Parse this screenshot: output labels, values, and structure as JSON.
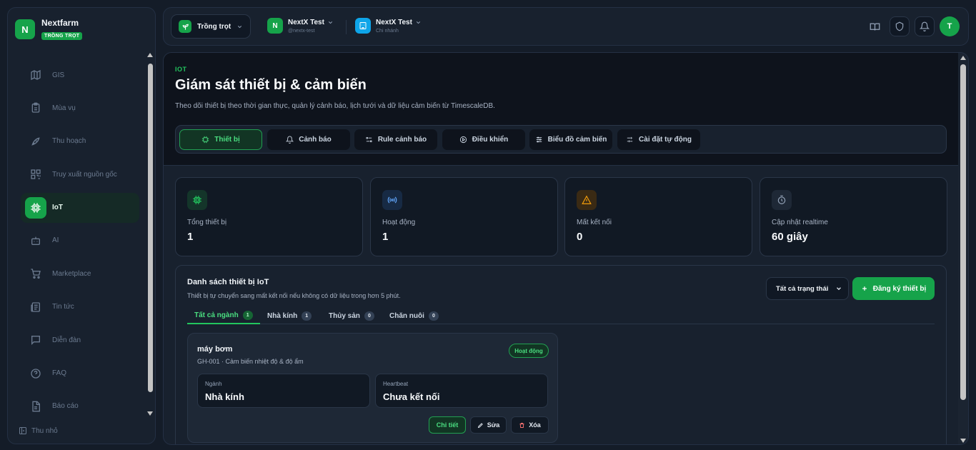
{
  "brand": {
    "name": "Nextfarm",
    "logo_letter": "N",
    "badge": "TRỒNG TRỌT"
  },
  "sidebar": {
    "items": [
      {
        "label": "GIS",
        "icon": "map-icon",
        "active": false
      },
      {
        "label": "Mùa vụ",
        "icon": "clipboard-icon",
        "active": false
      },
      {
        "label": "Thu hoạch",
        "icon": "rocket-icon",
        "active": false
      },
      {
        "label": "Truy xuất nguồn gốc",
        "icon": "qr-code-icon",
        "active": false
      },
      {
        "label": "IoT",
        "icon": "cpu-icon",
        "active": true
      },
      {
        "label": "AI",
        "icon": "robot-icon",
        "active": false
      },
      {
        "label": "Marketplace",
        "icon": "cart-icon",
        "active": false
      },
      {
        "label": "Tin tức",
        "icon": "newspaper-icon",
        "active": false
      },
      {
        "label": "Diễn đàn",
        "icon": "chat-icon",
        "active": false
      },
      {
        "label": "FAQ",
        "icon": "help-circle-icon",
        "active": false
      },
      {
        "label": "Báo cáo",
        "icon": "file-icon",
        "active": false
      }
    ],
    "collapse_label": "Thu nhỏ"
  },
  "topbar": {
    "crop_select": "Trồng trọt",
    "org": {
      "logo_letter": "N",
      "name": "NextX Test",
      "handle": "@nextx-test"
    },
    "branch": {
      "name": "NextX Test",
      "sub": "Chi nhánh"
    },
    "avatar_letter": "T"
  },
  "page": {
    "eyebrow": "IOT",
    "title": "Giám sát thiết bị & cảm biến",
    "description": "Theo dõi thiết bị theo thời gian thực, quản lý cảnh báo, lịch tưới và dữ liệu cảm biến từ TimescaleDB.",
    "tabs": [
      {
        "label": "Thiết bị",
        "icon": "chip-icon",
        "active": true
      },
      {
        "label": "Cảnh báo",
        "icon": "bell-icon",
        "active": false
      },
      {
        "label": "Rule cảnh báo",
        "icon": "rule-icon",
        "active": false
      },
      {
        "label": "Điều khiển",
        "icon": "play-icon",
        "active": false
      },
      {
        "label": "Biểu đồ cảm biến",
        "icon": "sliders-icon",
        "active": false
      },
      {
        "label": "Cài đặt tự động",
        "icon": "settings-sliders-icon",
        "active": false
      }
    ]
  },
  "stats": [
    {
      "label": "Tổng thiết bị",
      "value": "1",
      "icon": "chip-icon",
      "color": "#22c55e"
    },
    {
      "label": "Hoạt động",
      "value": "1",
      "icon": "broadcast-icon",
      "color": "#60a5fa"
    },
    {
      "label": "Mất kết nối",
      "value": "0",
      "icon": "warning-icon",
      "color": "#f59e0b"
    },
    {
      "label": "Cập nhật realtime",
      "value": "60 giây",
      "icon": "timer-icon",
      "color": "#94a3b8"
    }
  ],
  "devices_panel": {
    "title": "Danh sách thiết bị IoT",
    "description": "Thiết bị tự chuyển sang mất kết nối nếu không có dữ liệu trong hơn 5 phút.",
    "status_filter": "Tất cả trạng thái",
    "register_label": "Đăng ký thiết bị",
    "sector_tabs": [
      {
        "label": "Tất cả ngành",
        "count": "1",
        "active": true
      },
      {
        "label": "Nhà kính",
        "count": "1",
        "active": false
      },
      {
        "label": "Thủy sản",
        "count": "0",
        "active": false
      },
      {
        "label": "Chăn nuôi",
        "count": "0",
        "active": false
      }
    ],
    "device": {
      "name": "máy bơm",
      "meta": "GH-001 · Cảm biến nhiệt độ & độ ẩm",
      "status": "Hoạt động",
      "sector_label": "Ngành",
      "sector_value": "Nhà kính",
      "heartbeat_label": "Heartbeat",
      "heartbeat_value": "Chưa kết nối",
      "actions": {
        "detail": "Chi tiết",
        "edit": "Sửa",
        "delete": "Xóa"
      }
    }
  },
  "colors": {
    "accent": "#16a34a",
    "accent_text": "#4ade80",
    "background": "#141c28",
    "panel": "#18212e"
  }
}
